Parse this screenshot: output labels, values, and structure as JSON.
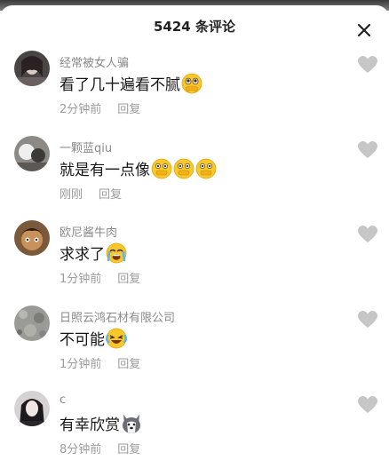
{
  "header": {
    "title": "5424 条评论"
  },
  "icons": {
    "close": "close-icon",
    "like": "heart-icon"
  },
  "colors": {
    "username": "#8a8a8a",
    "meta": "#9b9b9b",
    "heart": "#c6c6c6",
    "emoji": "#f7c82a"
  },
  "comments": [
    {
      "user": "经常被女人骗",
      "text": "看了几十遍看不腻",
      "emojis": [
        "praying-eyes-emoji"
      ],
      "time": "2分钟前",
      "reply": "回复"
    },
    {
      "user": "一颗蓝qiu",
      "text": "就是有一点像",
      "emojis": [
        "covering-mouth-emoji",
        "covering-mouth-emoji",
        "covering-mouth-emoji"
      ],
      "time": "刚刚",
      "reply": "回复"
    },
    {
      "user": "欧尼酱牛肉",
      "text": "求求了",
      "emojis": [
        "crying-emoji"
      ],
      "time": "1分钟前",
      "reply": "回复"
    },
    {
      "user": "日照云鸿石材有限公司",
      "text": "不可能",
      "emojis": [
        "laughing-tears-emoji"
      ],
      "time": "1分钟前",
      "reply": "回复"
    },
    {
      "user": "c",
      "text": "有幸欣赏",
      "emojis": [
        "husky-dog-emoji"
      ],
      "time": "8分钟前",
      "reply": "回复"
    }
  ]
}
